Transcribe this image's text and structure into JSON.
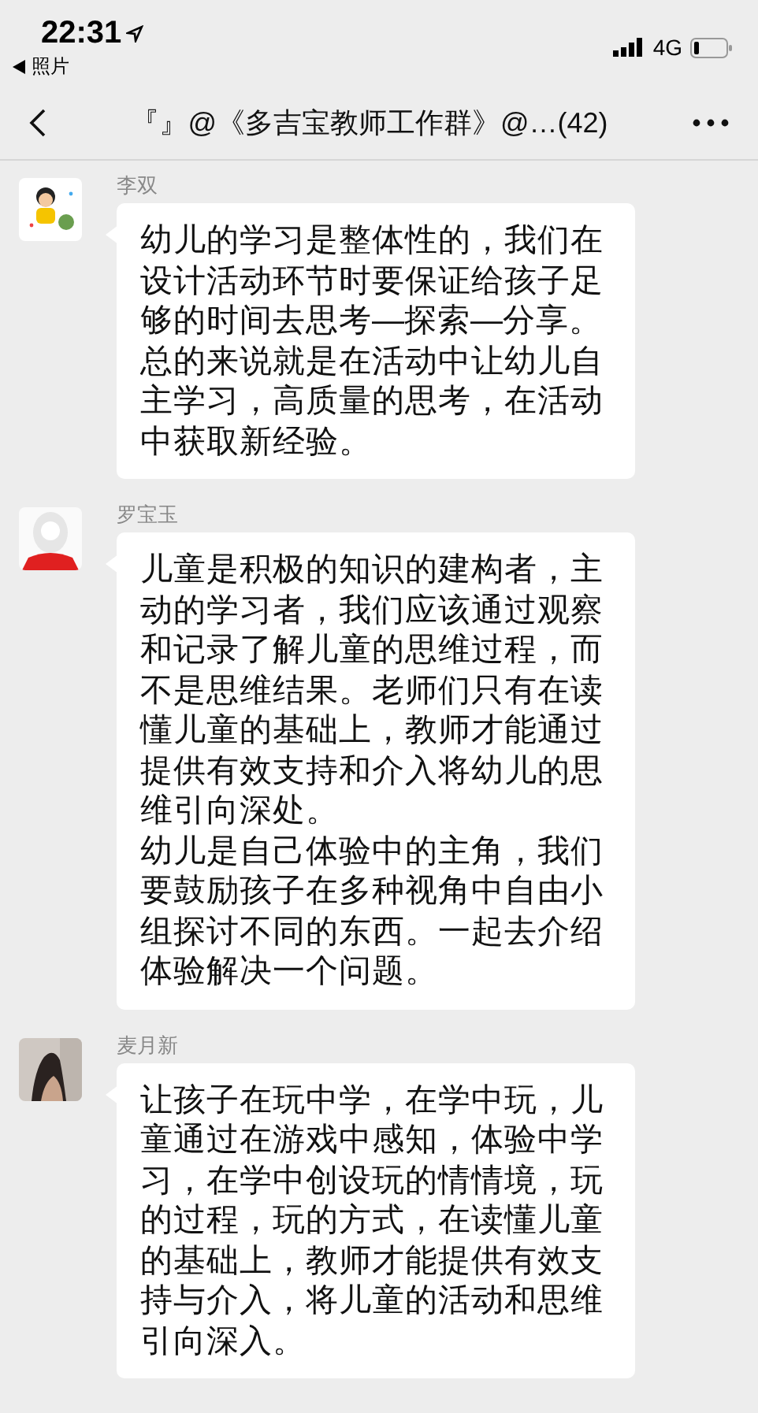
{
  "status_bar": {
    "time": "22:31",
    "back_app": "照片",
    "network": "4G"
  },
  "nav_bar": {
    "title": "『』@《多吉宝教师工作群》@…(42)"
  },
  "messages": [
    {
      "sender": "李双",
      "paragraphs": [
        "幼儿的学习是整体性的，我们在设计活动环节时要保证给孩子足够的时间去思考—探索—分享。总的来说就是在活动中让幼儿自主学习，高质量的思考，在活动中获取新经验。"
      ]
    },
    {
      "sender": "罗宝玉",
      "paragraphs": [
        "儿童是积极的知识的建构者，主动的学习者，我们应该通过观察和记录了解儿童的思维过程，而不是思维结果。老师们只有在读懂儿童的基础上，教师才能通过提供有效支持和介入将幼儿的思维引向深处。",
        "幼儿是自己体验中的主角，我们要鼓励孩子在多种视角中自由小组探讨不同的东西。一起去介绍体验解决一个问题。"
      ]
    },
    {
      "sender": "麦月新",
      "paragraphs": [
        "让孩子在玩中学，在学中玩，儿童通过在游戏中感知，体验中学习，在学中创设玩的情情境，玩的过程，玩的方式，在读懂儿童的基础上，教师才能提供有效支持与介入，将儿童的活动和思维引向深入。"
      ]
    }
  ]
}
